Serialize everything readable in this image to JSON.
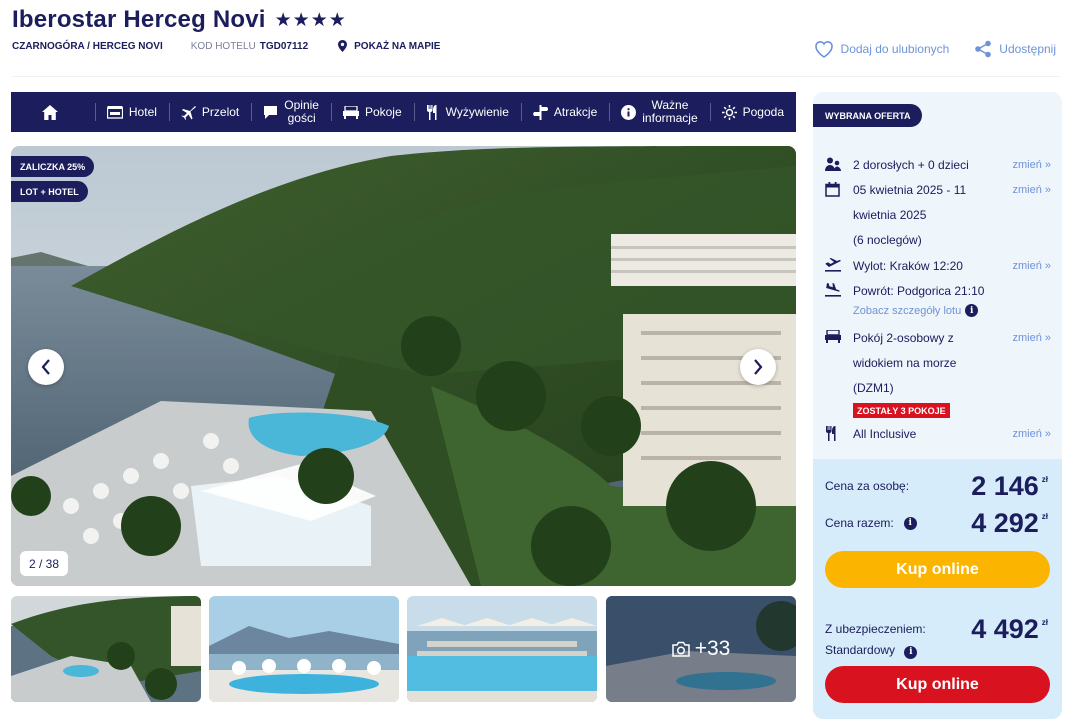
{
  "header": {
    "hotel_name": "Iberostar Herceg Novi",
    "stars": "★★★★",
    "location": "CZARNOGÓRA / HERCEG NOVI",
    "code_label": "KOD HOTELU",
    "code_value": "TGD07112",
    "map_link": "POKAŻ NA MAPIE",
    "favorite": "Dodaj do ulubionych",
    "share": "Udostępnij"
  },
  "nav": {
    "items": [
      {
        "label": "Hotel"
      },
      {
        "label": "Przelot"
      },
      {
        "label_line1": "Opinie",
        "label_line2": "gości"
      },
      {
        "label": "Pokoje"
      },
      {
        "label": "Wyżywienie"
      },
      {
        "label": "Atrakcje"
      },
      {
        "label_line1": "Ważne",
        "label_line2": "informacje"
      },
      {
        "label": "Pogoda"
      }
    ]
  },
  "gallery": {
    "badge_deposit": "ZALICZKA 25%",
    "badge_type": "LOT + HOTEL",
    "counter": "2 / 38",
    "more_count": "+33"
  },
  "offer": {
    "tag": "WYBRANA OFERTA",
    "change_label": "zmień »",
    "guests": "2 dorosłych + 0 dzieci",
    "dates_line1": "05 kwietnia 2025 - 11",
    "dates_line2": "kwietnia 2025",
    "nights": "(6 noclegów)",
    "departure": "Wylot: Kraków 12:20",
    "return": "Powrót: Podgorica 21:10",
    "flight_details": "Zobacz szczegóły lotu",
    "room_line1": "Pokój 2-osobowy z",
    "room_line2": "widokiem na morze",
    "room_code": "(DZM1)",
    "rooms_left": "ZOSTAŁY 3 POKOJE",
    "board": "All Inclusive",
    "price_per_person_label": "Cena za osobę:",
    "price_per_person": "2 146",
    "price_total_label": "Cena razem:",
    "price_total": "4 292",
    "currency": "zł",
    "buy_label": "Kup online",
    "insurance_label_line1": "Z ubezpieczeniem:",
    "insurance_label_line2": "Standardowy",
    "price_insured": "4 492"
  },
  "colors": {
    "navy": "#1b1d5c",
    "link": "#6e93d8",
    "yellow": "#fbb500",
    "red": "#d9121f",
    "panel": "#eef5fb",
    "price_panel": "#d6ecfa"
  }
}
